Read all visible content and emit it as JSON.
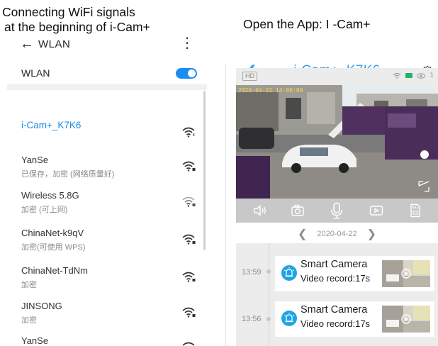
{
  "captions": {
    "left_line1": "Connecting WiFi signals",
    "left_line2": "at the beginning of i-Cam+",
    "right": "Open the App: I -Cam+"
  },
  "wlan": {
    "header_title": "WLAN",
    "back_icon": "arrow-left-icon",
    "more_icon": "more-vertical-icon",
    "toggle_label": "WLAN",
    "toggle_on": true,
    "networks": [
      {
        "name": "i-Cam+_K7K6",
        "status": "",
        "connected": true
      },
      {
        "name": "YanSe",
        "status": "已保存，加密 (网络质量好)",
        "connected": false
      },
      {
        "name": "Wireless 5.8G",
        "status": "加密 (可上网)",
        "connected": false
      },
      {
        "name": "ChinaNet-k9qV",
        "status": "加密(可使用 WPS)",
        "connected": false
      },
      {
        "name": "ChinaNet-TdNm",
        "status": "加密",
        "connected": false
      },
      {
        "name": "JINSONG",
        "status": "加密",
        "connected": false
      },
      {
        "name": "YanSe",
        "status": "",
        "connected": false
      }
    ]
  },
  "app": {
    "title": "i-Cam+_K7K6",
    "back_icon": "chevron-left-icon",
    "settings_icon": "gear-icon",
    "hd_label": "HD",
    "viewer_count": "1",
    "video_timestamp": "2020-04-22 14:00:00",
    "controls": [
      "speaker-icon",
      "camera-icon",
      "microphone-icon",
      "record-icon",
      "sd-card-icon"
    ],
    "date": "2020-04-22",
    "accent_color": "#3d9fe6",
    "records": [
      {
        "time": "13:59",
        "title": "Smart Camera",
        "subtitle": "Video record:17s"
      },
      {
        "time": "13:56",
        "title": "Smart Camera",
        "subtitle": "Video record:17s"
      }
    ]
  }
}
